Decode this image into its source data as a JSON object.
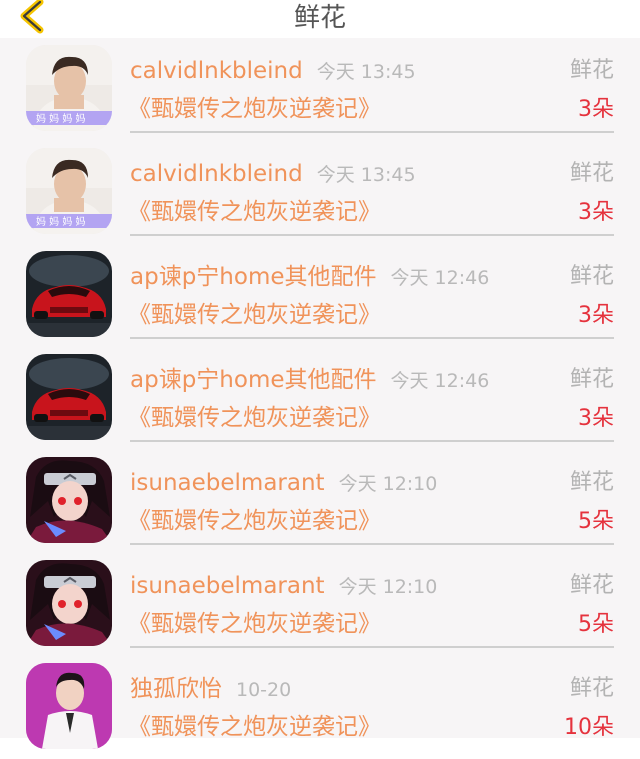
{
  "header": {
    "title": "鲜花",
    "back_icon": "chevron-left-icon",
    "accent_color": "#f5c400"
  },
  "colors": {
    "name": "#f0935a",
    "time": "#b9b9b9",
    "count": "#e5323d",
    "list_bg": "#f7f5f6"
  },
  "rows": [
    {
      "avatar": "boy-photo-avatar",
      "username": "calvidlnkbleind",
      "time": "今天 13:45",
      "type": "鲜花",
      "book": "《甄嬛传之炮灰逆袭记》",
      "count": "3朵"
    },
    {
      "avatar": "boy-photo-avatar",
      "username": "calvidlnkbleind",
      "time": "今天 13:45",
      "type": "鲜花",
      "book": "《甄嬛传之炮灰逆袭记》",
      "count": "3朵"
    },
    {
      "avatar": "red-car-avatar",
      "username": "ap谏p宁home其他配件",
      "time": "今天 12:46",
      "type": "鲜花",
      "book": "《甄嬛传之炮灰逆袭记》",
      "count": "3朵"
    },
    {
      "avatar": "red-car-avatar",
      "username": "ap谏p宁home其他配件",
      "time": "今天 12:46",
      "type": "鲜花",
      "book": "《甄嬛传之炮灰逆袭记》",
      "count": "3朵"
    },
    {
      "avatar": "anime-ninja-avatar",
      "username": "isunaebelmarant",
      "time": "今天 12:10",
      "type": "鲜花",
      "book": "《甄嬛传之炮灰逆袭记》",
      "count": "5朵"
    },
    {
      "avatar": "anime-ninja-avatar",
      "username": "isunaebelmarant",
      "time": "今天 12:10",
      "type": "鲜花",
      "book": "《甄嬛传之炮灰逆袭记》",
      "count": "5朵"
    },
    {
      "avatar": "man-stage-avatar",
      "username": "独孤欣怡",
      "time": "10-20",
      "type": "鲜花",
      "book": "《甄嬛传之炮灰逆袭记》",
      "count": "10朵"
    }
  ]
}
